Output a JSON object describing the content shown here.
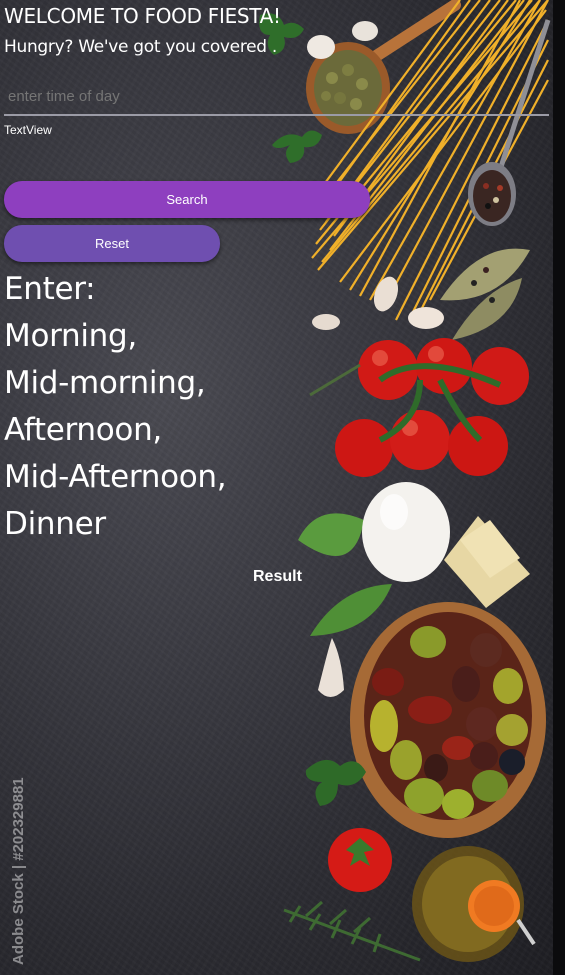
{
  "header": {
    "title": "WELCOME TO FOOD FIESTA!",
    "subtitle": "Hungry? We've got you covered ."
  },
  "form": {
    "time_input_placeholder": "enter time of day",
    "text_view": "TextView",
    "search_label": "Search",
    "reset_label": "Reset"
  },
  "instructions": {
    "lines": [
      "Enter: Morning,",
      "Mid-morning,",
      "Afternoon,",
      "Mid-Afternoon,",
      "Dinner"
    ]
  },
  "result": {
    "label": "Result"
  },
  "watermark": {
    "text": "Adobe Stock | #202329881"
  },
  "colors": {
    "search_button": "#8e3fbf",
    "reset_button": "#6f4fb0",
    "background": "#3a3a41",
    "input_underline": "#9b9ba6"
  }
}
